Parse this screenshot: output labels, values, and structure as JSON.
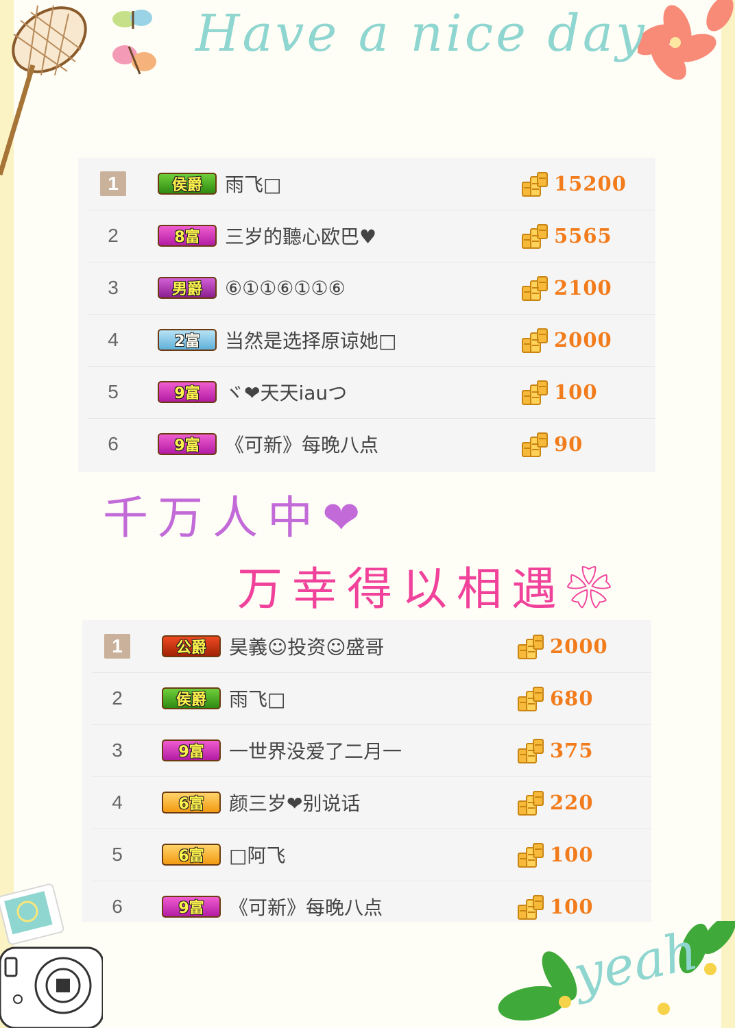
{
  "header": {
    "title": "Have a nice day"
  },
  "footer": {
    "signature": "yeah"
  },
  "colors": {
    "accent_amount": "#f27c1c",
    "poem_line1": "#c26ad8",
    "poem_line2": "#f0429b",
    "headline": "#8fd5d0"
  },
  "board1": {
    "rows": [
      {
        "rank": "1",
        "badge": "侯爵",
        "badge_style": "marquis",
        "name": "雨飞□",
        "amount": "15200"
      },
      {
        "rank": "2",
        "badge": "8富",
        "badge_style": "rich-magenta",
        "name": "三岁的聽心欧巴♥",
        "amount": "5565"
      },
      {
        "rank": "3",
        "badge": "男爵",
        "badge_style": "baron",
        "name": "⑥①①⑥①①⑥",
        "amount": "2100"
      },
      {
        "rank": "4",
        "badge": "2富",
        "badge_style": "rich-blue",
        "name": "当然是选择原谅她□",
        "amount": "2000"
      },
      {
        "rank": "5",
        "badge": "9富",
        "badge_style": "rich-magenta",
        "name": "ヾ❤天天iauつ",
        "amount": "100"
      },
      {
        "rank": "6",
        "badge": "9富",
        "badge_style": "rich-magenta",
        "name": "《可新》每晚八点",
        "amount": "90"
      }
    ]
  },
  "poem": {
    "line1": "千万人中❤",
    "line2": "万幸得以相遇❀"
  },
  "board2": {
    "rows": [
      {
        "rank": "1",
        "badge": "公爵",
        "badge_style": "duke",
        "name": "昊義☺投资☺盛哥",
        "amount": "2000"
      },
      {
        "rank": "2",
        "badge": "侯爵",
        "badge_style": "marquis",
        "name": "雨飞□",
        "amount": "680"
      },
      {
        "rank": "3",
        "badge": "9富",
        "badge_style": "rich-magenta",
        "name": "一世界没爱了二月一",
        "amount": "375"
      },
      {
        "rank": "4",
        "badge": "6富",
        "badge_style": "rich-orange",
        "name": "颜三岁❤别说话",
        "amount": "220"
      },
      {
        "rank": "5",
        "badge": "6富",
        "badge_style": "rich-orange",
        "name": "□阿飞",
        "amount": "100"
      },
      {
        "rank": "6",
        "badge": "9富",
        "badge_style": "rich-magenta",
        "name": "《可新》每晚八点",
        "amount": "100"
      }
    ]
  },
  "icons": {
    "coin": "gold-coin-stack-icon",
    "net": "butterfly-net-icon",
    "butterfly": "butterfly-icon",
    "flower": "lily-flower-icon",
    "camera": "camera-icon",
    "leaves": "leaves-icon"
  }
}
